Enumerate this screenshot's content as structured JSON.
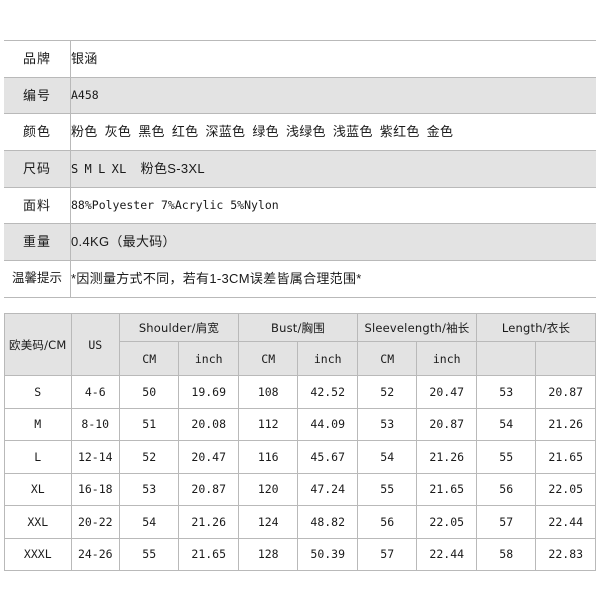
{
  "spec_table": {
    "name": "product-spec-table",
    "rows": [
      {
        "label": "品牌",
        "value": "银涵"
      },
      {
        "label": "编号",
        "value": "A458"
      },
      {
        "label": "颜色",
        "value": "粉色 灰色 黑色 红色 深蓝色 绿色 浅绿色 浅蓝色 紫红色 金色"
      },
      {
        "label": "尺码",
        "value": "S M L XL  粉色S-3XL"
      },
      {
        "label": "面料",
        "value": "88%Polyester  7%Acrylic  5%Nylon"
      },
      {
        "label": "重量",
        "value": "0.4KG（最大码）"
      },
      {
        "label": "温馨提示",
        "value": "*因测量方式不同，若有1-3CM误差皆属合理范围*"
      }
    ],
    "colors": [
      "粉色",
      "灰色",
      "黑色",
      "红色",
      "深蓝色",
      "绿色",
      "浅绿色",
      "浅蓝色",
      "紫红色",
      "金色"
    ],
    "sizes": [
      "S",
      "M",
      "L",
      "XL"
    ],
    "size_note": "粉色S-3XL",
    "fabric": "88%Polyester  7%Acrylic  5%Nylon",
    "weight": "0.4KG（最大码）",
    "tip": "*因测量方式不同，若有1-3CM误差皆属合理范围*"
  },
  "size_table": {
    "name": "size-chart-table",
    "group_headers": [
      {
        "label": "欧美码/CM",
        "span": 1
      },
      {
        "label": "US",
        "span": 1
      },
      {
        "label": "Shoulder/肩宽",
        "span": 2
      },
      {
        "label": "Bust/胸围",
        "span": 2
      },
      {
        "label": "Sleevelength/袖长",
        "span": 2
      },
      {
        "label": "Length/衣长",
        "span": 2
      }
    ],
    "unit_headers": [
      "",
      "",
      "CM",
      "inch",
      "CM",
      "inch",
      "CM",
      "inch"
    ],
    "rows": [
      {
        "eu": "S",
        "us": "4-6",
        "shoulder_cm": "50",
        "shoulder_in": "19.69",
        "bust_cm": "108",
        "bust_in": "42.52",
        "sleeve_cm": "52",
        "sleeve_in": "20.47",
        "length_cm": "53",
        "length_in": "20.87"
      },
      {
        "eu": "M",
        "us": "8-10",
        "shoulder_cm": "51",
        "shoulder_in": "20.08",
        "bust_cm": "112",
        "bust_in": "44.09",
        "sleeve_cm": "53",
        "sleeve_in": "20.87",
        "length_cm": "54",
        "length_in": "21.26"
      },
      {
        "eu": "L",
        "us": "12-14",
        "shoulder_cm": "52",
        "shoulder_in": "20.47",
        "bust_cm": "116",
        "bust_in": "45.67",
        "sleeve_cm": "54",
        "sleeve_in": "21.26",
        "length_cm": "55",
        "length_in": "21.65"
      },
      {
        "eu": "XL",
        "us": "16-18",
        "shoulder_cm": "53",
        "shoulder_in": "20.87",
        "bust_cm": "120",
        "bust_in": "47.24",
        "sleeve_cm": "55",
        "sleeve_in": "21.65",
        "length_cm": "56",
        "length_in": "22.05"
      },
      {
        "eu": "XXL",
        "us": "20-22",
        "shoulder_cm": "54",
        "shoulder_in": "21.26",
        "bust_cm": "124",
        "bust_in": "48.82",
        "sleeve_cm": "56",
        "sleeve_in": "22.05",
        "length_cm": "57",
        "length_in": "22.44"
      },
      {
        "eu": "XXXL",
        "us": "24-26",
        "shoulder_cm": "55",
        "shoulder_in": "21.65",
        "bust_cm": "128",
        "bust_in": "50.39",
        "sleeve_cm": "57",
        "sleeve_in": "22.44",
        "length_cm": "58",
        "length_in": "22.83"
      }
    ]
  },
  "colors_palette": {
    "page_background": "#ffffff",
    "row_shade": "#e3e3e3",
    "border": "#b9b9b9",
    "text": "#1a1a1a"
  }
}
